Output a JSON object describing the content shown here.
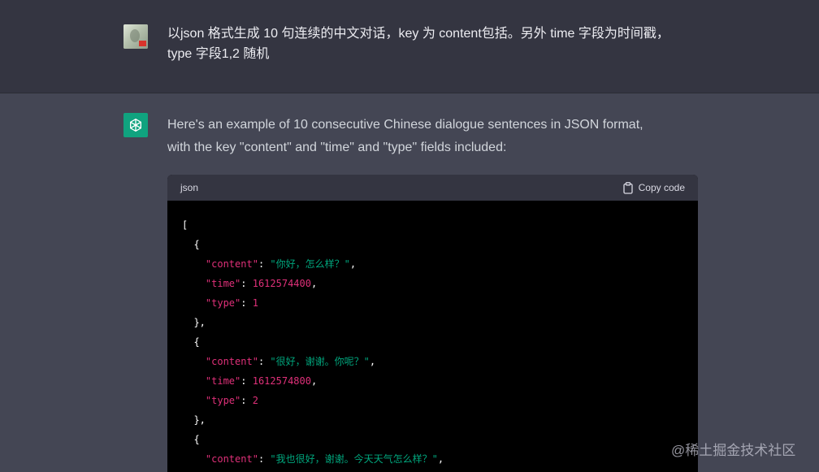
{
  "user_message": {
    "line1": "以json 格式生成 10 句连续的中文对话，key 为 content包括。另外 time 字段为时间戳，",
    "line2": "type 字段1,2 随机"
  },
  "assistant_message": {
    "line1": "Here's an example of 10 consecutive Chinese dialogue sentences in JSON format,",
    "line2": "with the key \"content\" and \"time\" and \"type\" fields included:"
  },
  "code_block": {
    "language": "json",
    "copy_label": "Copy code",
    "entries": [
      {
        "content": "\"你好，怎么样？\"",
        "time": "1612574400",
        "type": "1"
      },
      {
        "content": "\"很好，谢谢。你呢？\"",
        "time": "1612574800",
        "type": "2"
      },
      {
        "content": "\"我也很好，谢谢。今天天气怎么样？\""
      }
    ],
    "keys": {
      "content": "\"content\"",
      "time": "\"time\"",
      "type": "\"type\""
    }
  },
  "watermark": "@稀土掘金技术社区",
  "colors": {
    "page_bg": "#444654",
    "user_row_bg": "#343541",
    "code_bg": "#000000",
    "key_color": "#df3079",
    "string_color": "#00a67d",
    "bot_avatar_bg": "#10a37f"
  }
}
